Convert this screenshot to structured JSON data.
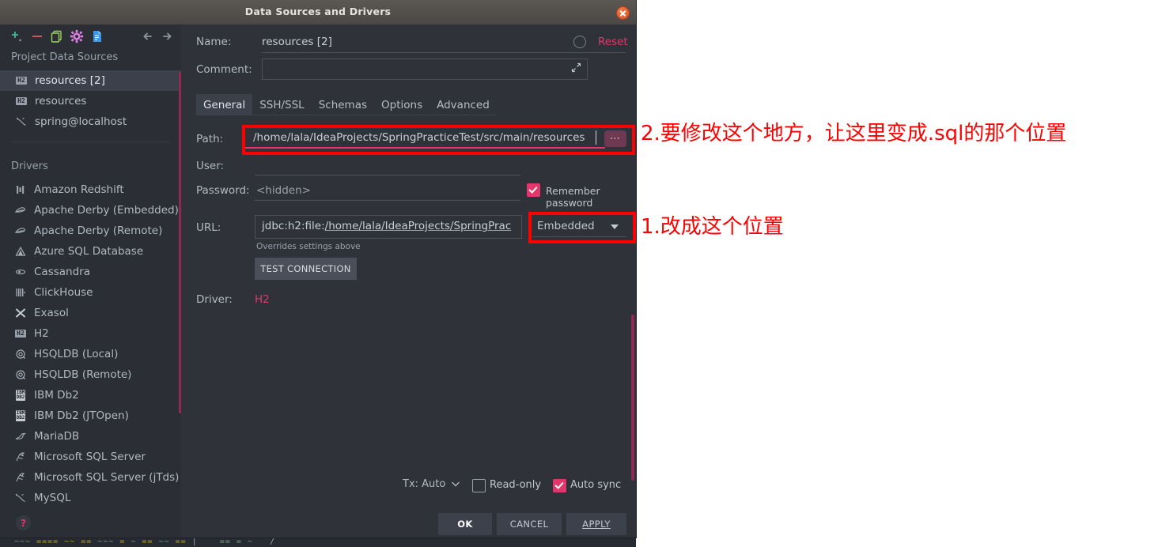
{
  "window": {
    "title": "Data Sources and Drivers",
    "close_icon": "close-icon"
  },
  "toolbar": {
    "icons": [
      {
        "name": "add-icon",
        "label": "+"
      },
      {
        "name": "remove-icon",
        "label": "−"
      },
      {
        "name": "copy-icon",
        "label": "copy"
      },
      {
        "name": "settings-gear-icon",
        "label": "gear"
      },
      {
        "name": "file-icon",
        "label": "file"
      },
      {
        "name": "nav-back-icon",
        "label": "←"
      },
      {
        "name": "nav-forward-icon",
        "label": "→"
      }
    ]
  },
  "sidebar": {
    "project_header": "Project Data Sources",
    "data_sources": [
      {
        "label": "resources [2]",
        "icon": "h2-icon",
        "selected": true
      },
      {
        "label": "resources",
        "icon": "h2-icon",
        "selected": false
      },
      {
        "label": "spring@localhost",
        "icon": "mysql-icon",
        "selected": false
      }
    ],
    "drivers_header": "Drivers",
    "drivers": [
      {
        "label": "Amazon Redshift",
        "icon": "redshift-icon"
      },
      {
        "label": "Apache Derby (Embedded)",
        "icon": "derby-icon"
      },
      {
        "label": "Apache Derby (Remote)",
        "icon": "derby-icon"
      },
      {
        "label": "Azure SQL Database",
        "icon": "azure-icon"
      },
      {
        "label": "Cassandra",
        "icon": "cassandra-icon"
      },
      {
        "label": "ClickHouse",
        "icon": "clickhouse-icon"
      },
      {
        "label": "Exasol",
        "icon": "exasol-icon"
      },
      {
        "label": "H2",
        "icon": "h2-icon"
      },
      {
        "label": "HSQLDB (Local)",
        "icon": "hsqldb-icon"
      },
      {
        "label": "HSQLDB (Remote)",
        "icon": "hsqldb-icon"
      },
      {
        "label": "IBM Db2",
        "icon": "db2-icon"
      },
      {
        "label": "IBM Db2 (JTOpen)",
        "icon": "db2-icon"
      },
      {
        "label": "MariaDB",
        "icon": "mariadb-icon"
      },
      {
        "label": "Microsoft SQL Server",
        "icon": "mssql-icon"
      },
      {
        "label": "Microsoft SQL Server (jTds)",
        "icon": "mssql-icon"
      },
      {
        "label": "MySQL",
        "icon": "mysql-icon"
      }
    ],
    "help_icon": "help-icon",
    "help_label": "?"
  },
  "form": {
    "name_label": "Name:",
    "name_value": "resources [2]",
    "reset_label": "Reset",
    "comment_label": "Comment:",
    "comment_value": "",
    "expand_icon": "expand-icon",
    "tabs": [
      {
        "label": "General",
        "active": true
      },
      {
        "label": "SSH/SSL",
        "active": false
      },
      {
        "label": "Schemas",
        "active": false
      },
      {
        "label": "Options",
        "active": false
      },
      {
        "label": "Advanced",
        "active": false
      }
    ],
    "path_label": "Path:",
    "path_value": "/home/lala/IdeaProjects/SpringPracticeTest/src/main/resources",
    "browse_icon": "ellipsis-browse-icon",
    "user_label": "User:",
    "user_value": "",
    "password_label": "Password:",
    "password_value": "<hidden>",
    "remember_password_label": "Remember password",
    "remember_password_checked": true,
    "url_label": "URL:",
    "url_value_prefix": "jdbc:h2:file:",
    "url_value_path": "/home/lala/IdeaProjects/SpringPrac",
    "overrides_note": "Overrides settings above",
    "test_connection_label": "TEST CONNECTION",
    "connection_type": "Embedded",
    "connection_type_icon": "chevron-down-icon",
    "driver_label": "Driver:",
    "driver_value": "H2"
  },
  "footer": {
    "tx_label": "Tx: Auto",
    "tx_chevron_icon": "chevron-down-icon",
    "readonly_label": "Read-only",
    "readonly_checked": false,
    "autosync_label": "Auto sync",
    "autosync_checked": true,
    "ok_label": "OK",
    "cancel_label": "CANCEL",
    "apply_label": "APPLY"
  },
  "annotations": [
    {
      "id": "anno-2",
      "text": "2.要修改这个地方，让这里变成.sql的那个位置",
      "color": "#ff0000"
    },
    {
      "id": "anno-1",
      "text": "1.改成这个位置",
      "color": "#ff0000"
    }
  ],
  "colors": {
    "accent_pink": "#e3366b",
    "annotation_red": "#ff0000",
    "dialog_bg": "#2f3239",
    "sidebar_bg": "#2b2e35",
    "selection_bg": "#3b404b"
  }
}
